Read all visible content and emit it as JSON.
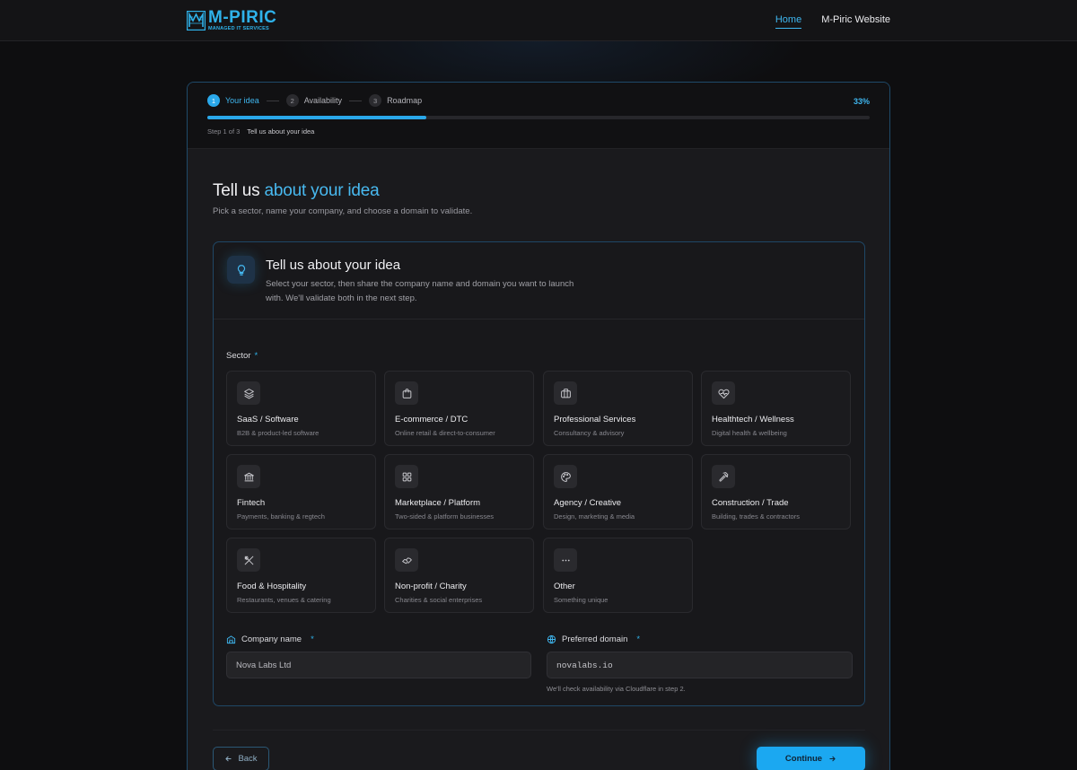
{
  "brand": {
    "title": "M-PIRIC",
    "subtitle": "MANAGED IT SERVICES"
  },
  "nav": {
    "home": "Home",
    "website": "M-Piric Website"
  },
  "wizard": {
    "steps": [
      {
        "num": "1",
        "label": "Your idea"
      },
      {
        "num": "2",
        "label": "Availability"
      },
      {
        "num": "3",
        "label": "Roadmap"
      }
    ],
    "progress_percent": 33,
    "progress_label": "33%",
    "step_counter": "Step 1 of 3",
    "step_title": "Tell us about your idea"
  },
  "page": {
    "title_plain": "Tell us ",
    "title_highlight": "about your idea",
    "subtitle": "Pick a sector, name your company, and choose a domain to validate."
  },
  "card": {
    "title": "Tell us about your idea",
    "description": "Select your sector, then share the company name and domain you want to launch with. We'll validate both in the next step."
  },
  "sector": {
    "label": "Sector",
    "required_mark": "*",
    "options": [
      {
        "icon": "layers-icon",
        "title": "SaaS / Software",
        "sub": "B2B & product-led software"
      },
      {
        "icon": "shopping-bag-icon",
        "title": "E-commerce / DTC",
        "sub": "Online retail & direct-to-consumer"
      },
      {
        "icon": "briefcase-icon",
        "title": "Professional Services",
        "sub": "Consultancy & advisory"
      },
      {
        "icon": "heart-pulse-icon",
        "title": "Healthtech / Wellness",
        "sub": "Digital health & wellbeing"
      },
      {
        "icon": "bank-icon",
        "title": "Fintech",
        "sub": "Payments, banking & regtech"
      },
      {
        "icon": "grid-icon",
        "title": "Marketplace / Platform",
        "sub": "Two-sided & platform businesses"
      },
      {
        "icon": "palette-icon",
        "title": "Agency / Creative",
        "sub": "Design, marketing & media"
      },
      {
        "icon": "hammer-icon",
        "title": "Construction / Trade",
        "sub": "Building, trades & contractors"
      },
      {
        "icon": "utensils-icon",
        "title": "Food & Hospitality",
        "sub": "Restaurants, venues & catering"
      },
      {
        "icon": "handshake-icon",
        "title": "Non-profit / Charity",
        "sub": "Charities & social enterprises"
      },
      {
        "icon": "more-horizontal-icon",
        "title": "Other",
        "sub": "Something unique"
      }
    ]
  },
  "company": {
    "label": "Company name",
    "required_mark": "*",
    "value": "Nova Labs Ltd"
  },
  "domain": {
    "label": "Preferred domain",
    "required_mark": "*",
    "value": "novalabs.io",
    "hint": "We'll check availability via Cloudflare in step 2."
  },
  "actions": {
    "back": "Back",
    "continue": "Continue"
  },
  "colors": {
    "accent": "#2aa8ea",
    "background": "#0e0e10",
    "panel": "#1a1a1d"
  }
}
